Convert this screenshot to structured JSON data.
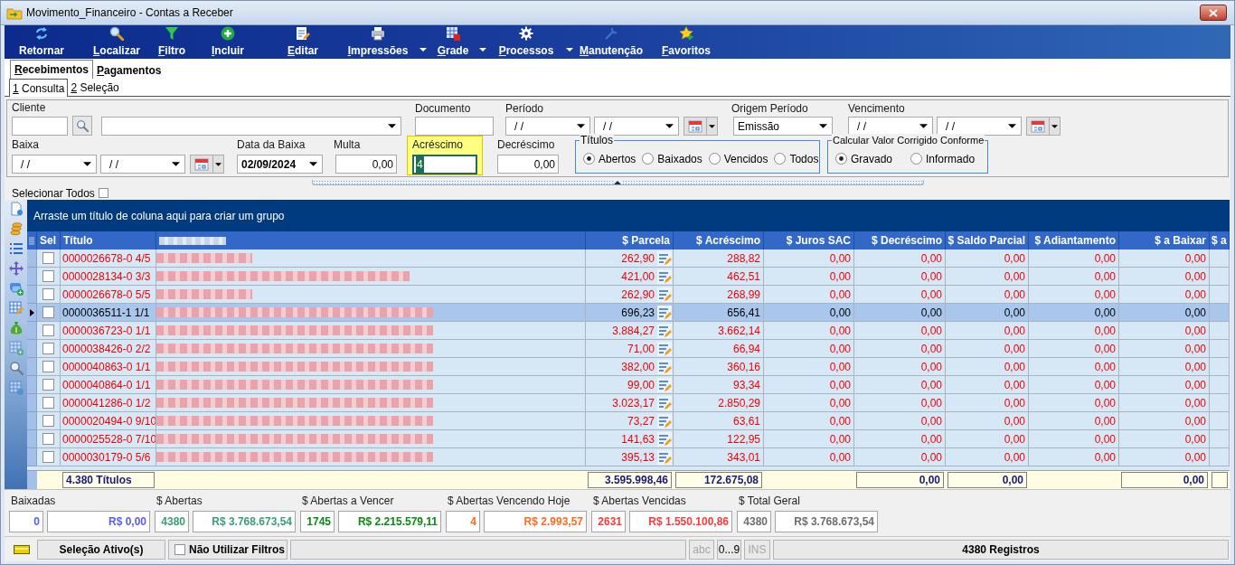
{
  "window": {
    "title": "Movimento_Financeiro - Contas a Receber"
  },
  "toolbar": [
    {
      "label": "Retornar",
      "accelerator": false,
      "has_menu": false
    },
    {
      "label": "Localizar",
      "accelerator": true,
      "has_menu": false
    },
    {
      "label": "Filtro",
      "accelerator": true,
      "has_menu": false
    },
    {
      "label": "Incluir",
      "accelerator": true,
      "has_menu": false
    },
    {
      "label": "Editar",
      "accelerator": true,
      "has_menu": false
    },
    {
      "label": "Impressões",
      "accelerator": true,
      "has_menu": true
    },
    {
      "label": "Grade",
      "accelerator": true,
      "has_menu": true
    },
    {
      "label": "Processos",
      "accelerator": true,
      "has_menu": true
    },
    {
      "label": "Manutenção",
      "accelerator": true,
      "has_menu": false
    },
    {
      "label": "Favoritos",
      "accelerator": true,
      "has_menu": false
    }
  ],
  "tabs": [
    {
      "label": "Recebimentos",
      "selected": true,
      "accelerator": true
    },
    {
      "label": "Pagamentos",
      "selected": false,
      "accelerator": true
    }
  ],
  "subtabs": [
    {
      "label": "1 Consulta",
      "selected": true,
      "accelerator": true
    },
    {
      "label": "2 Seleção",
      "selected": false,
      "accelerator": true
    }
  ],
  "filters": {
    "cliente": {
      "label": "Cliente"
    },
    "documento": {
      "label": "Documento"
    },
    "periodo": {
      "label": "Período",
      "from": "/ /",
      "to": "/ /"
    },
    "origem_periodo": {
      "label": "Origem Período",
      "value": "Emissão"
    },
    "vencimento": {
      "label": "Vencimento",
      "from": "/ /",
      "to": "/ /"
    },
    "baixa": {
      "label": "Baixa",
      "from": "/ /",
      "to": "/ /"
    },
    "data_da_baixa": {
      "label": "Data da Baixa",
      "value": "02/09/2024"
    },
    "multa": {
      "label": "Multa",
      "value": "0,00"
    },
    "acrescimo": {
      "label": "Acréscimo",
      "value": "4",
      "highlighted": true
    },
    "decrescimo": {
      "label": "Decréscimo",
      "value": "0,00"
    },
    "titulos": {
      "label": "Títulos",
      "options": [
        {
          "label": "Abertos",
          "selected": true
        },
        {
          "label": "Baixados",
          "selected": false
        },
        {
          "label": "Vencidos",
          "selected": false
        },
        {
          "label": "Todos",
          "selected": false
        }
      ]
    },
    "calcular_conforme": {
      "label": "Calcular Valor Corrigido Conforme",
      "options": [
        {
          "label": "Gravado",
          "selected": true
        },
        {
          "label": "Informado",
          "selected": false
        }
      ]
    }
  },
  "select_all": {
    "label": "Selecionar Todos",
    "checked": false
  },
  "grid": {
    "group_hint": "Arraste um título de coluna aqui para criar um grupo",
    "columns": [
      {
        "label": "Sel",
        "kind": "checkbox"
      },
      {
        "label": "Título",
        "kind": "text",
        "has_total": true,
        "total": "4.380 Títulos"
      },
      {
        "kind": "redacted"
      },
      {
        "label": "$ Parcela",
        "kind": "amount_edit",
        "has_total": true,
        "total": "3.595.998,46"
      },
      {
        "label": "$ Acréscimo",
        "kind": "amount",
        "has_total": true,
        "total": "172.675,08"
      },
      {
        "label": "$ Juros SAC",
        "kind": "amount",
        "has_total": false
      },
      {
        "label": "$ Decréscimo",
        "kind": "amount",
        "has_total": true,
        "total": "0,00"
      },
      {
        "label": "$ Saldo Parcial",
        "kind": "amount",
        "has_total": true,
        "total": "0,00"
      },
      {
        "label": "$ Adiantamento",
        "kind": "amount",
        "has_total": false
      },
      {
        "label": "$ a Baixar",
        "kind": "amount",
        "has_total": true,
        "total": "0,00"
      },
      {
        "label": "$ a",
        "kind": "amount",
        "has_total": true
      }
    ],
    "rows": [
      {
        "kind": "short",
        "selected": false,
        "checked": false,
        "titulo": "0000026678-0 4/5",
        "amounts": [
          "262,90",
          "288,82",
          "0,00",
          "0,00",
          "0,00",
          "0,00",
          "0,00"
        ]
      },
      {
        "kind": "medium",
        "selected": false,
        "checked": false,
        "titulo": "0000028134-0 3/3",
        "amounts": [
          "421,00",
          "462,51",
          "0,00",
          "0,00",
          "0,00",
          "0,00",
          "0,00"
        ]
      },
      {
        "kind": "short",
        "selected": false,
        "checked": false,
        "titulo": "0000026678-0 5/5",
        "amounts": [
          "262,90",
          "268,99",
          "0,00",
          "0,00",
          "0,00",
          "0,00",
          "0,00"
        ]
      },
      {
        "kind": "long",
        "selected": true,
        "checked": false,
        "titulo": "0000036511-1 1/1",
        "amounts": [
          "696,23",
          "656,41",
          "0,00",
          "0,00",
          "0,00",
          "0,00",
          "0,00"
        ]
      },
      {
        "kind": "long",
        "selected": false,
        "checked": false,
        "titulo": "0000036723-0 1/1",
        "amounts": [
          "3.884,27",
          "3.662,14",
          "0,00",
          "0,00",
          "0,00",
          "0,00",
          "0,00"
        ]
      },
      {
        "kind": "long",
        "selected": false,
        "checked": false,
        "titulo": "0000038426-0 2/2",
        "amounts": [
          "71,00",
          "66,94",
          "0,00",
          "0,00",
          "0,00",
          "0,00",
          "0,00"
        ]
      },
      {
        "kind": "long",
        "selected": false,
        "checked": false,
        "titulo": "0000040863-0 1/1",
        "amounts": [
          "382,00",
          "360,16",
          "0,00",
          "0,00",
          "0,00",
          "0,00",
          "0,00"
        ]
      },
      {
        "kind": "long",
        "selected": false,
        "checked": false,
        "titulo": "0000040864-0 1/1",
        "amounts": [
          "99,00",
          "93,34",
          "0,00",
          "0,00",
          "0,00",
          "0,00",
          "0,00"
        ]
      },
      {
        "kind": "long",
        "selected": false,
        "checked": false,
        "titulo": "0000041286-0 1/2",
        "amounts": [
          "3.023,17",
          "2.850,29",
          "0,00",
          "0,00",
          "0,00",
          "0,00",
          "0,00"
        ]
      },
      {
        "kind": "long",
        "selected": false,
        "checked": false,
        "titulo": "0000020494-0 9/10",
        "amounts": [
          "73,27",
          "63,61",
          "0,00",
          "0,00",
          "0,00",
          "0,00",
          "0,00"
        ]
      },
      {
        "kind": "long",
        "selected": false,
        "checked": false,
        "titulo": "0000025528-0 7/10",
        "amounts": [
          "141,63",
          "122,95",
          "0,00",
          "0,00",
          "0,00",
          "0,00",
          "0,00"
        ]
      },
      {
        "kind": "long",
        "selected": false,
        "checked": false,
        "titulo": "0000030179-0 5/6",
        "amounts": [
          "395,13",
          "343,01",
          "0,00",
          "0,00",
          "0,00",
          "0,00",
          "0,00"
        ]
      }
    ]
  },
  "summary": [
    {
      "label": "Baixadas",
      "count": "0",
      "amount": "R$ 0,00",
      "color": "#5a5aff"
    },
    {
      "label": "$ Abertas",
      "count": "4380",
      "amount": "R$ 3.768.673,54",
      "color": "#3a9e74"
    },
    {
      "label": "$ Abertas a Vencer",
      "count": "1745",
      "amount": "R$ 2.215.579,11",
      "color": "#0a8a14"
    },
    {
      "label": "$ Abertas Vencendo Hoje",
      "count": "4",
      "amount": "R$ 2.993,57",
      "color": "#ff6a1e"
    },
    {
      "label": "$ Abertas Vencidas",
      "count": "2631",
      "amount": "R$ 1.550.100,86",
      "color": "#ff3838"
    },
    {
      "label": "$ Total Geral",
      "count": "4380",
      "amount": "R$ 3.768.673,54",
      "color": "#6e6e6e"
    }
  ],
  "status_bar": {
    "selection": "Seleção Ativo(s)",
    "no_filters": {
      "label": "Não Utilizar Filtros",
      "checked": false
    },
    "indicators": [
      {
        "label": "abc",
        "on": false
      },
      {
        "label": "0...9",
        "on": true
      },
      {
        "label": "INS",
        "on": false
      }
    ],
    "records": "4380 Registros"
  }
}
